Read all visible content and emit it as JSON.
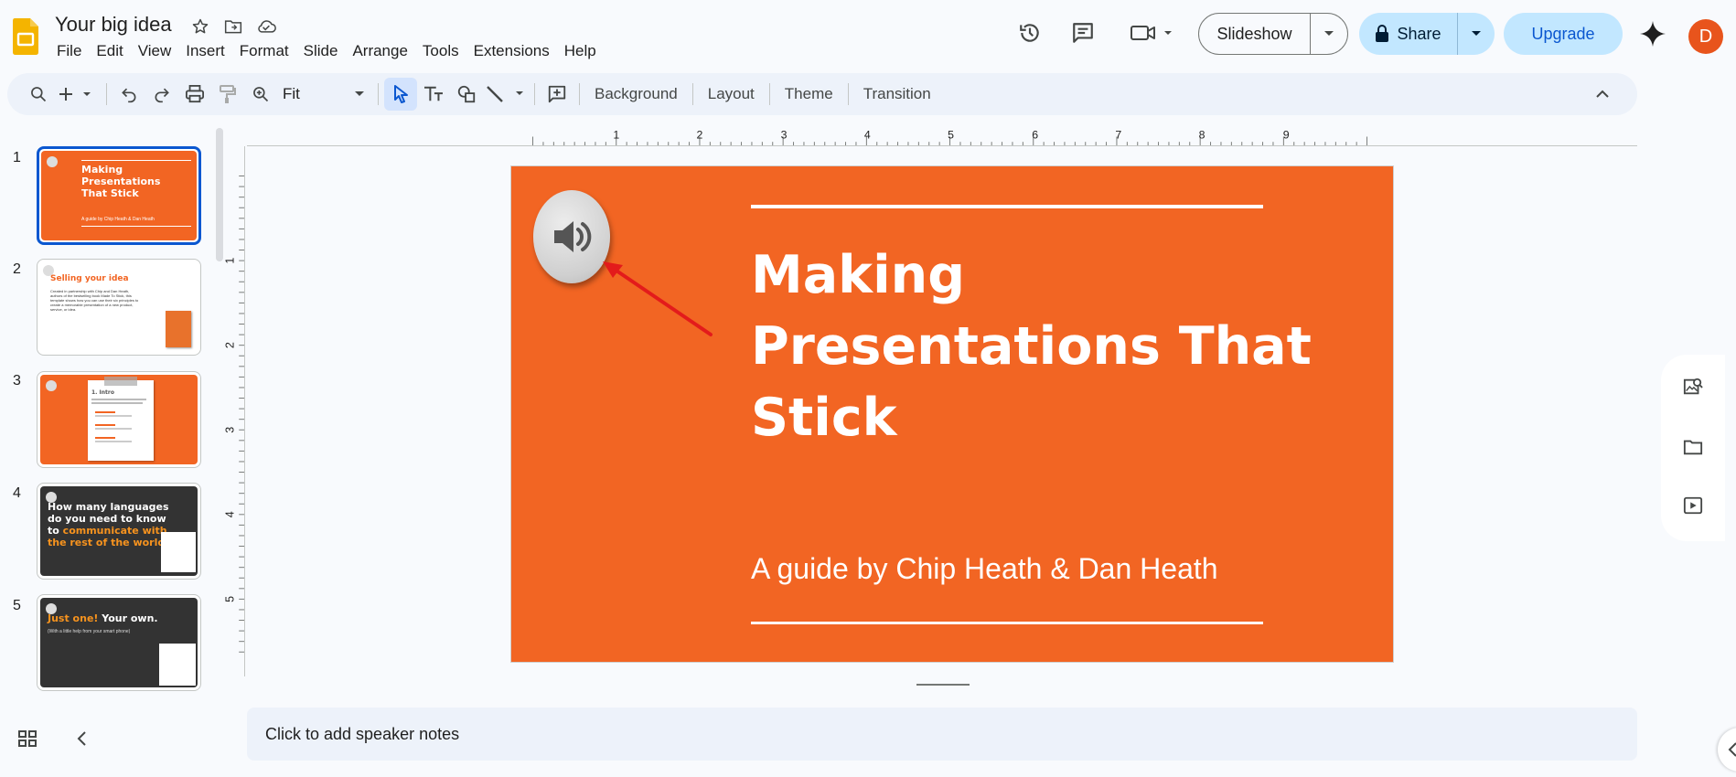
{
  "app": {
    "doc_title": "Your big idea",
    "menu": [
      "File",
      "Edit",
      "View",
      "Insert",
      "Format",
      "Slide",
      "Arrange",
      "Tools",
      "Extensions",
      "Help"
    ]
  },
  "header": {
    "slideshow_label": "Slideshow",
    "share_label": "Share",
    "upgrade_label": "Upgrade",
    "avatar_initial": "D"
  },
  "toolbar": {
    "zoom_value": "Fit",
    "background_label": "Background",
    "layout_label": "Layout",
    "theme_label": "Theme",
    "transition_label": "Transition"
  },
  "ruler": {
    "h_ticks": [
      "1",
      "2",
      "3",
      "4",
      "5",
      "6",
      "7",
      "8",
      "9"
    ],
    "v_ticks": [
      "1",
      "2",
      "3",
      "4",
      "5"
    ]
  },
  "filmstrip": {
    "numbers": [
      "1",
      "2",
      "3",
      "4",
      "5"
    ],
    "slides": [
      {
        "title": "Making Presentations That Stick",
        "subtitle": "A guide by Chip Heath & Dan Heath"
      },
      {
        "title": "Selling your idea",
        "body": "Created in partnership with Chip and Dan Heath, authors of the bestselling book Made To Stick, this template shows how you can use their six principles to create a memorable presentation of a new product, service, or idea."
      },
      {
        "title": "1. Intro"
      },
      {
        "title_a": "How many languages do you need to know to",
        "title_b": "communicate with the rest of the world?"
      },
      {
        "title_a": "Just one!",
        "title_b": "Your own.",
        "body": "(With a little help from your smart phone)"
      }
    ]
  },
  "slide": {
    "title": "Making Presentations That Stick",
    "subtitle": "A guide by Chip Heath & Dan Heath"
  },
  "notes": {
    "placeholder": "Click to add speaker notes"
  },
  "colors": {
    "slide_bg": "#f26523",
    "dark_slide_bg": "#333333",
    "accent_orange": "#f7931e",
    "selection_blue": "#0b57d0",
    "share_bg": "#c2e7ff",
    "avatar_bg": "#e8541c",
    "arrow_red": "#e31b1b"
  },
  "icons": [
    "slides-logo-icon",
    "star-icon",
    "move-folder-icon",
    "cloud-saved-icon",
    "history-icon",
    "comment-icon",
    "camera-icon",
    "lock-icon",
    "gemini-icon",
    "search-icon",
    "plus-icon",
    "undo-icon",
    "redo-icon",
    "print-icon",
    "paint-format-icon",
    "zoom-icon",
    "cursor-icon",
    "textbox-icon",
    "shape-icon",
    "line-icon",
    "comment-add-icon",
    "chevron-up-icon",
    "speaker-icon",
    "grid-view-icon",
    "chevron-left-icon",
    "image-search-icon",
    "folder-icon",
    "video-add-icon"
  ]
}
